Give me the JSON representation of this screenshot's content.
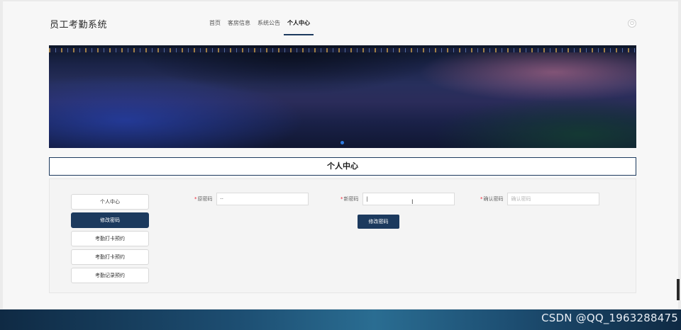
{
  "header": {
    "brand": "员工考勤系统",
    "nav": [
      "首页",
      "客房信息",
      "系统公告",
      "个人中心"
    ],
    "active_nav": "个人中心",
    "power_icon": "power-icon"
  },
  "title": "个人中心",
  "sidebar": {
    "items": [
      "个人中心",
      "修改密码",
      "考勤打卡预约",
      "考勤打卡预约",
      "考勤记录预约"
    ],
    "active": "修改密码"
  },
  "form": {
    "old_password": {
      "label": "原密码",
      "value": "··"
    },
    "new_password": {
      "label": "新密码",
      "value": "|"
    },
    "confirm_password": {
      "label": "确认密码",
      "placeholder": "确认密码"
    },
    "submit_label": "修改密码"
  },
  "watermark": "CSDN @QQ_1963288475",
  "colors": {
    "accent": "#1c3a5e",
    "required": "#e22233"
  }
}
